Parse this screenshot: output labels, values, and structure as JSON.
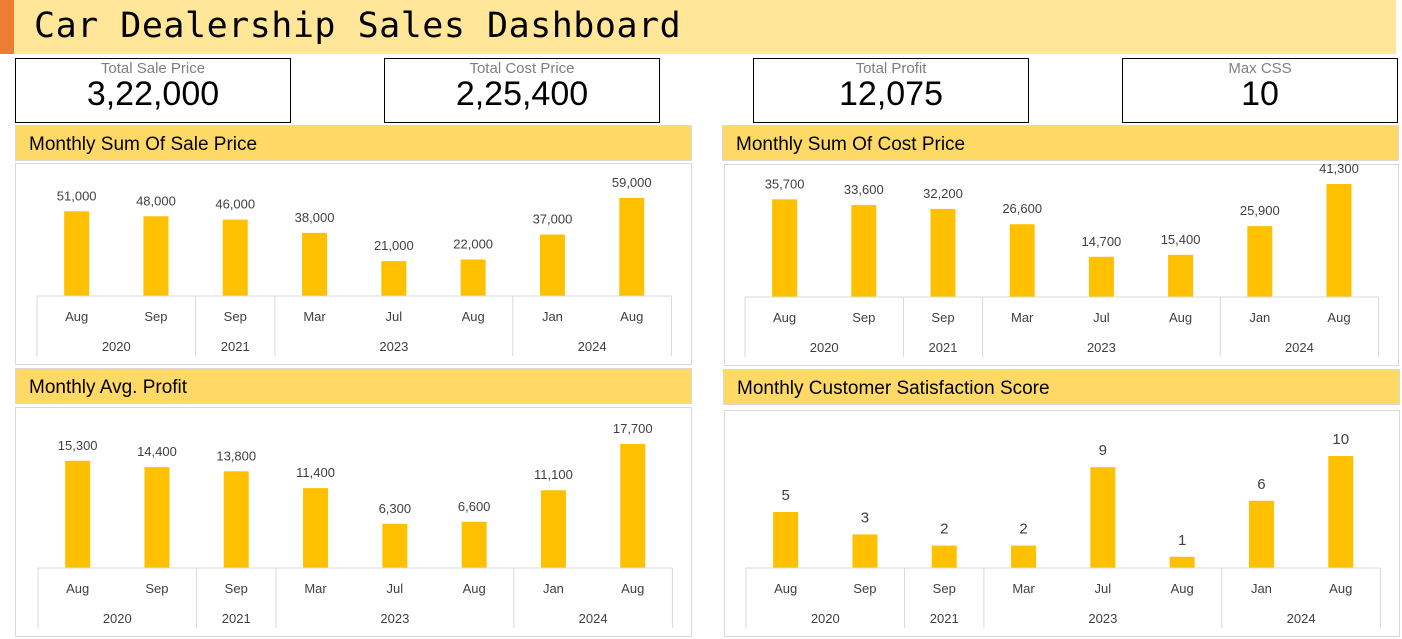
{
  "dashboard": {
    "title": "Car Dealership Sales Dashboard"
  },
  "kpis": [
    {
      "label": "Total Sale Price",
      "value": "3,22,000"
    },
    {
      "label": "Total Cost Price",
      "value": "2,25,400"
    },
    {
      "label": "Total Profit",
      "value": "12,075"
    },
    {
      "label": "Max CSS",
      "value": "10"
    }
  ],
  "colors": {
    "bar": "#ffc000",
    "header": "#ffd966",
    "title_bar": "#ffe699",
    "accent": "#ed7d31"
  },
  "chart_data": [
    {
      "type": "bar",
      "title": "Monthly Sum Of Sale Price",
      "categories": [
        "Aug",
        "Sep",
        "Sep",
        "Mar",
        "Jul",
        "Aug",
        "Jan",
        "Aug"
      ],
      "groups": [
        {
          "label": "2020",
          "count": 2
        },
        {
          "label": "2021",
          "count": 1
        },
        {
          "label": "2023",
          "count": 3
        },
        {
          "label": "2024",
          "count": 2
        }
      ],
      "values": [
        51000,
        48000,
        46000,
        38000,
        21000,
        22000,
        37000,
        59000
      ],
      "data_labels": [
        "51,000",
        "48,000",
        "46,000",
        "38,000",
        "21,000",
        "22,000",
        "37,000",
        "59,000"
      ],
      "ylim": [
        0,
        70000
      ],
      "grid": false,
      "legend": "none"
    },
    {
      "type": "bar",
      "title": "Monthly Sum Of Cost Price",
      "categories": [
        "Aug",
        "Sep",
        "Sep",
        "Mar",
        "Jul",
        "Aug",
        "Jan",
        "Aug"
      ],
      "groups": [
        {
          "label": "2020",
          "count": 2
        },
        {
          "label": "2021",
          "count": 1
        },
        {
          "label": "2023",
          "count": 3
        },
        {
          "label": "2024",
          "count": 2
        }
      ],
      "values": [
        35700,
        33600,
        32200,
        26600,
        14700,
        15400,
        25900,
        41300
      ],
      "data_labels": [
        "35,700",
        "33,600",
        "32,200",
        "26,600",
        "14,700",
        "15,400",
        "25,900",
        "41,300"
      ],
      "ylim": [
        0,
        50000
      ],
      "grid": false,
      "legend": "none"
    },
    {
      "type": "bar",
      "title": "Monthly Avg. Profit",
      "categories": [
        "Aug",
        "Sep",
        "Sep",
        "Mar",
        "Jul",
        "Aug",
        "Jan",
        "Aug"
      ],
      "groups": [
        {
          "label": "2020",
          "count": 2
        },
        {
          "label": "2021",
          "count": 1
        },
        {
          "label": "2023",
          "count": 3
        },
        {
          "label": "2024",
          "count": 2
        }
      ],
      "values": [
        15300,
        14400,
        13800,
        11400,
        6300,
        6600,
        11100,
        17700
      ],
      "data_labels": [
        "15,300",
        "14,400",
        "13,800",
        "11,400",
        "6,300",
        "6,600",
        "11,100",
        "17,700"
      ],
      "ylim": [
        0,
        20000
      ],
      "grid": false,
      "legend": "none"
    },
    {
      "type": "bar",
      "title": "Monthly Customer Satisfaction Score",
      "categories": [
        "Aug",
        "Sep",
        "Sep",
        "Mar",
        "Jul",
        "Aug",
        "Jan",
        "Aug"
      ],
      "groups": [
        {
          "label": "2020",
          "count": 2
        },
        {
          "label": "2021",
          "count": 1
        },
        {
          "label": "2023",
          "count": 3
        },
        {
          "label": "2024",
          "count": 2
        }
      ],
      "values": [
        5,
        3,
        2,
        2,
        9,
        1,
        6,
        10
      ],
      "data_labels": [
        "5",
        "3",
        "2",
        "2",
        "9",
        "1",
        "6",
        "10"
      ],
      "ylim": [
        0,
        12
      ],
      "grid": false,
      "legend": "none"
    }
  ]
}
